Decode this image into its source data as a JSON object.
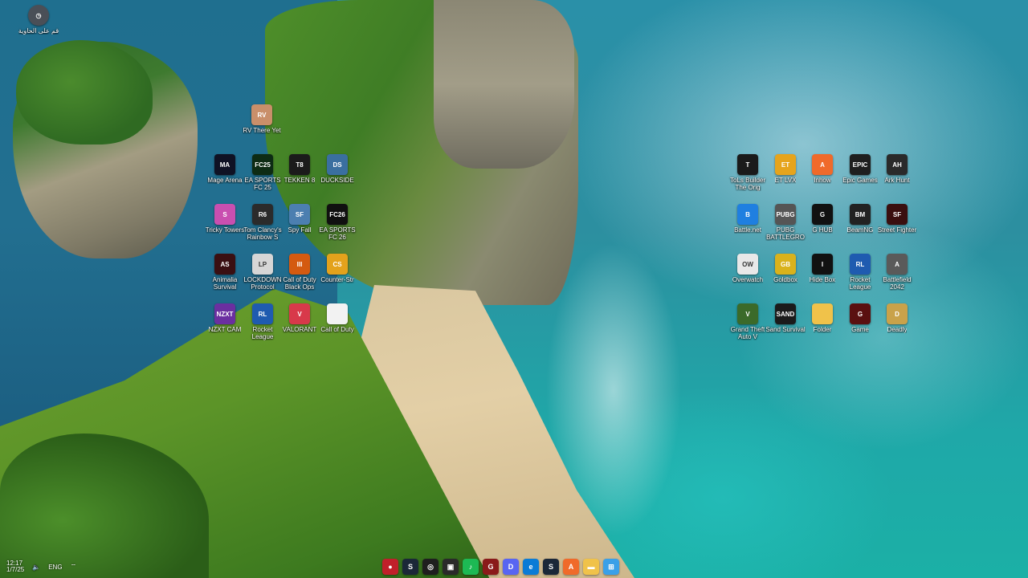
{
  "desktop": {
    "top_left": {
      "label": "قم على الحاوية",
      "icon": "recycle-circle-icon",
      "color": "#4a4f57"
    },
    "icons_left": [
      {
        "label": "RV There Yet",
        "icon": "rv-game-icon",
        "color": "#c98f6a",
        "abbr": "RV"
      },
      {
        "label": "Mage Arena",
        "icon": "mage-arena-icon",
        "color": "#0f1224",
        "abbr": "MA"
      },
      {
        "label": "EA SPORTS FC 25",
        "icon": "ea-fc25-icon",
        "color": "#0d2b14",
        "abbr": "FC25"
      },
      {
        "label": "TEKKEN 8",
        "icon": "tekken8-icon",
        "color": "#1b1b1b",
        "abbr": "T8"
      },
      {
        "label": "DUCKSIDE",
        "icon": "duckside-icon",
        "color": "#3a6fa0",
        "abbr": "DS"
      },
      {
        "label": "Tricky Towers",
        "icon": "tricky-towers-icon",
        "color": "#c94fb0",
        "abbr": "S"
      },
      {
        "label": "Tom Clancy's Rainbow S",
        "icon": "rainbow-six-icon",
        "color": "#2b2b2b",
        "abbr": "R6"
      },
      {
        "label": "Spy Fall",
        "icon": "spyfall-icon",
        "color": "#4c7fb0",
        "abbr": "SF"
      },
      {
        "label": "EA SPORTS FC 26",
        "icon": "ea-fc26-icon",
        "color": "#101010",
        "abbr": "FC26"
      },
      {
        "label": "Animalia Survival",
        "icon": "animalia-icon",
        "color": "#3a0f12",
        "abbr": "AS"
      },
      {
        "label": "LOCKDOWN Protocol",
        "icon": "lockdown-icon",
        "color": "#d6d6d6",
        "abbr": "LP"
      },
      {
        "label": "Call of Duty Black Ops",
        "icon": "cod-black-ops-icon",
        "color": "#d45a10",
        "abbr": "III"
      },
      {
        "label": "Counter-Str",
        "icon": "counter-strike-icon",
        "color": "#e3a21c",
        "abbr": "CS"
      },
      {
        "label": "NZXT CAM",
        "icon": "nzxt-cam-icon",
        "color": "#6b2fa0",
        "abbr": "NZXT"
      },
      {
        "label": "Rocket League",
        "icon": "rocket-league-icon",
        "color": "#1f5bb0",
        "abbr": "RL"
      },
      {
        "label": "VALORANT",
        "icon": "valorant-icon",
        "color": "#d8394a",
        "abbr": "V"
      },
      {
        "label": "Call of Duty",
        "icon": "file-icon",
        "color": "#f2f2f2",
        "abbr": ""
      }
    ],
    "icons_right": [
      {
        "label": "ToLs Builder The Orig",
        "icon": "app-dark-icon",
        "color": "#1a1a1a",
        "abbr": "T"
      },
      {
        "label": "ET LVX",
        "icon": "et-app-icon",
        "color": "#e6a41c",
        "abbr": "ET"
      },
      {
        "label": "Inhow",
        "icon": "arc-launcher-icon",
        "color": "#f06a2a",
        "abbr": "A"
      },
      {
        "label": "Epic Games",
        "icon": "epic-games-icon",
        "color": "#1f1f1f",
        "abbr": "EPIC"
      },
      {
        "label": "Ark Hunt",
        "icon": "game-dark-icon",
        "color": "#2a2a2a",
        "abbr": "AH"
      },
      {
        "label": "Battle.net",
        "icon": "battlenet-icon",
        "color": "#1f7fe0",
        "abbr": "B"
      },
      {
        "label": "PUBG BATTLEGRO",
        "icon": "pubg-icon",
        "color": "#555",
        "abbr": "PUBG"
      },
      {
        "label": "G HUB",
        "icon": "logitech-ghub-icon",
        "color": "#111",
        "abbr": "G"
      },
      {
        "label": "BeamNG",
        "icon": "beamng-icon",
        "color": "#222",
        "abbr": "BM"
      },
      {
        "label": "Street Fighter",
        "icon": "street-fighter-icon",
        "color": "#3a0f0f",
        "abbr": "SF"
      },
      {
        "label": "Overwatch",
        "icon": "overwatch-icon",
        "color": "#e8e8e8",
        "abbr": "OW"
      },
      {
        "label": "Goldbox",
        "icon": "gold-app-icon",
        "color": "#d9b21c",
        "abbr": "GB"
      },
      {
        "label": "Hide Box",
        "icon": "hide-box-icon",
        "color": "#111",
        "abbr": "I"
      },
      {
        "label": "Rocket League",
        "icon": "rocket-league-icon",
        "color": "#1f5bb0",
        "abbr": "RL"
      },
      {
        "label": "Battlefield 2042",
        "icon": "battlefield-icon",
        "color": "#5a5a5a",
        "abbr": "A"
      },
      {
        "label": "Grand Theft Auto V",
        "icon": "gta-icon",
        "color": "#3b6a2a",
        "abbr": "V"
      },
      {
        "label": "Sand Survival",
        "icon": "sand-icon",
        "color": "#1b1b1b",
        "abbr": "SAND"
      },
      {
        "label": "Folder",
        "icon": "folder-icon",
        "color": "#f0c24a",
        "abbr": ""
      },
      {
        "label": "Game",
        "icon": "game-red-icon",
        "color": "#5a1010",
        "abbr": "G"
      },
      {
        "label": "Deadly",
        "icon": "shield-game-icon",
        "color": "#c9a24a",
        "abbr": "D"
      }
    ]
  },
  "taskbar": {
    "tray": {
      "time": "12:17",
      "date": "1/7/25",
      "lang": "ENG",
      "volume": "volume-icon",
      "network": "wifi-icon"
    },
    "apps": [
      {
        "name": "app-red-dot",
        "color": "#c0202a",
        "abbr": "●"
      },
      {
        "name": "steam",
        "color": "#1b2838",
        "abbr": "S"
      },
      {
        "name": "chrome",
        "color": "#1f1f1f",
        "abbr": "◎"
      },
      {
        "name": "capture",
        "color": "#2a2a2a",
        "abbr": "▣"
      },
      {
        "name": "spotify",
        "color": "#1db954",
        "abbr": "♪"
      },
      {
        "name": "game-app",
        "color": "#8a1a1a",
        "abbr": "G"
      },
      {
        "name": "discord",
        "color": "#5865f2",
        "abbr": "D"
      },
      {
        "name": "edge",
        "color": "#0a7bd6",
        "abbr": "e"
      },
      {
        "name": "steam-2",
        "color": "#1b2838",
        "abbr": "S"
      },
      {
        "name": "arc",
        "color": "#f06a2a",
        "abbr": "A"
      },
      {
        "name": "file-explorer",
        "color": "#f0c24a",
        "abbr": "▬"
      },
      {
        "name": "windows",
        "color": "#3aa0e8",
        "abbr": "⊞"
      }
    ]
  }
}
